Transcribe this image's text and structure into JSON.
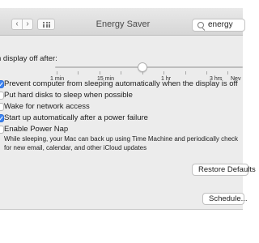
{
  "window": {
    "title": "Energy Saver",
    "search_value": "energy"
  },
  "slider": {
    "label": "n display off after:",
    "value_fraction": 0.45,
    "ticks": [
      "1 min",
      "15 min",
      "1 hr",
      "3 hrs",
      "Nev"
    ]
  },
  "options": [
    {
      "label": "Prevent computer from sleeping automatically when the display is off",
      "checked": true
    },
    {
      "label": "Put hard disks to sleep when possible",
      "checked": false
    },
    {
      "label": "Wake for network access",
      "checked": false
    },
    {
      "label": "Start up automatically after a power failure",
      "checked": true
    },
    {
      "label": "Enable Power Nap",
      "checked": false
    }
  ],
  "power_nap_description": "While sleeping, your Mac can back up using Time Machine and periodically check for new email, calendar, and other iCloud updates",
  "buttons": {
    "restore_defaults": "Restore Defaults",
    "schedule": "Schedule..."
  },
  "colors": {
    "accent": "#3b82f0",
    "panel": "#ececec"
  }
}
